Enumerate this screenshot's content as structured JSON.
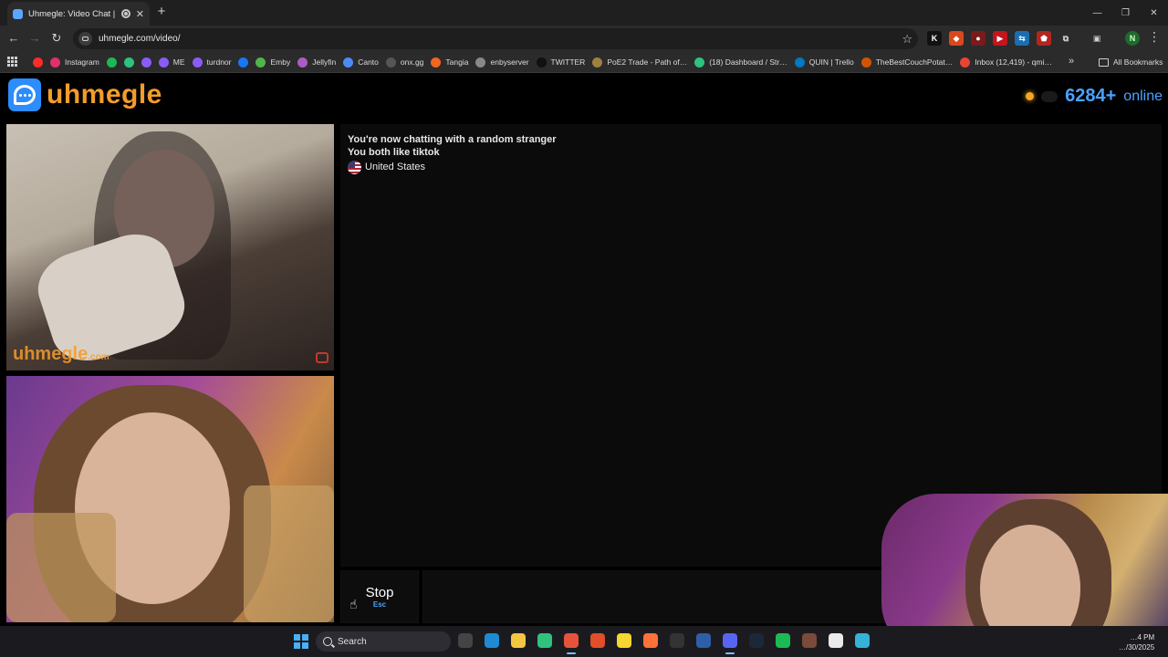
{
  "browser": {
    "tab_title": "Uhmegle: Video Chat | Ran…",
    "new_tab_label": "+",
    "url": "uhmegle.com/video/",
    "window_controls": [
      "—",
      "❐",
      "✕"
    ]
  },
  "bookmarks": [
    {
      "label": "",
      "color": "#ff2a2a"
    },
    {
      "label": "Instagram",
      "color": "#e1306c"
    },
    {
      "label": "",
      "color": "#1db954"
    },
    {
      "label": "",
      "color": "#2ec27e"
    },
    {
      "label": "",
      "color": "#8a5cf6"
    },
    {
      "label": "ME",
      "color": "#8a5cf6"
    },
    {
      "label": "turdnor",
      "color": "#8a5cf6"
    },
    {
      "label": "",
      "color": "#1877f2"
    },
    {
      "label": "Emby",
      "color": "#52b54b"
    },
    {
      "label": "Jellyfin",
      "color": "#aa5cc3"
    },
    {
      "label": "Canto",
      "color": "#4c8bf5"
    },
    {
      "label": "onx.gg",
      "color": "#555555"
    },
    {
      "label": "Tangia",
      "color": "#f26522"
    },
    {
      "label": "enbyserver",
      "color": "#888888"
    },
    {
      "label": "TWITTER",
      "color": "#111111"
    },
    {
      "label": "PoE2 Trade - Path of…",
      "color": "#a08040"
    },
    {
      "label": "(18) Dashboard / Str…",
      "color": "#2ec27e"
    },
    {
      "label": "QUIN | Trello",
      "color": "#0079bf"
    },
    {
      "label": "TheBestCouchPotat…",
      "color": "#d35400"
    },
    {
      "label": "Inbox (12,419) - qmi…",
      "color": "#ea4335"
    }
  ],
  "bookmarks_more": "»",
  "all_bookmarks": "All Bookmarks",
  "profile_initial": "N",
  "site": {
    "logo_text": "uhmegle",
    "online_count": "6284+",
    "online_label": "online"
  },
  "video": {
    "watermark": "uhmegle",
    "watermark_suffix": ".com"
  },
  "chat": {
    "messages": [
      "You're now chatting with a random stranger",
      "You both like tiktok"
    ],
    "country": "United States"
  },
  "controls": {
    "stop_label": "Stop",
    "stop_key": "Esc"
  },
  "taskbar": {
    "search_label": "Search",
    "time": "…4 PM",
    "date": "…/30/2025"
  },
  "colors": {
    "brand_orange": "#f39c2c",
    "brand_blue": "#2c8dfb",
    "online_blue": "#4aa3ff"
  }
}
